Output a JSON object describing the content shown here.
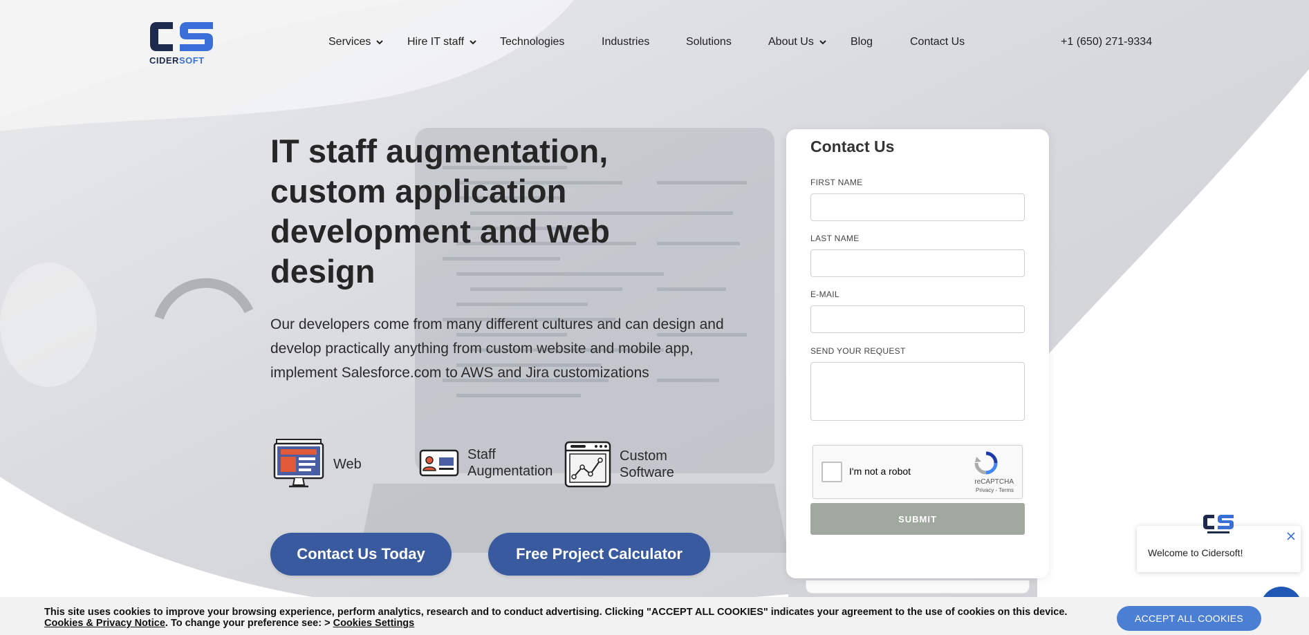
{
  "brand": {
    "logo_text_a": "CIDER",
    "logo_text_b": "SOFT",
    "color_dark": "#1d2a4d",
    "color_accent": "#3a6fd8"
  },
  "nav": {
    "items": [
      {
        "label": "Services",
        "dropdown": true
      },
      {
        "label": "Hire IT staff",
        "dropdown": true
      },
      {
        "label": "Technologies",
        "dropdown": false
      },
      {
        "label": "Industries",
        "dropdown": false
      },
      {
        "label": "Solutions",
        "dropdown": false
      },
      {
        "label": "About Us",
        "dropdown": true
      },
      {
        "label": "Blog",
        "dropdown": false
      },
      {
        "label": "Contact Us",
        "dropdown": false
      }
    ],
    "phone": "+1 (650) 271-9334"
  },
  "hero": {
    "title": "IT staff augmentation, custom application development and web design",
    "description": "Our developers come from many different cultures and can design and develop practically anything from custom website and mobile app, implement Salesforce.com to AWS and Jira customizations",
    "services": [
      {
        "label": "Web",
        "icon": "web-monitor-icon"
      },
      {
        "label": "Staff Augmentation",
        "icon": "id-card-icon"
      },
      {
        "label": "Custom Software",
        "icon": "software-chart-icon"
      }
    ],
    "cta_primary": "Contact Us Today",
    "cta_secondary": "Free Project Calculator",
    "cta_color": "#3a5aa0"
  },
  "contact_form": {
    "title": "Contact Us",
    "first_name_label": "FIRST NAME",
    "last_name_label": "LAST NAME",
    "email_label": "E-MAIL",
    "request_label": "SEND YOUR REQUEST",
    "recaptcha_label": "I'm not a robot",
    "recaptcha_brand": "reCAPTCHA",
    "recaptcha_terms": "Privacy - Terms",
    "submit_label": "SUBMIT",
    "submit_color": "#a0a89f"
  },
  "chat": {
    "message": "Welcome to Cidersoft!",
    "bubble_color": "#1e57b4"
  },
  "cookie": {
    "text": "This site uses cookies to improve your browsing experience, perform analytics, research and to conduct advertising. Clicking \"ACCEPT ALL COOKIES\" indicates your agreement to the use of cookies on this device.",
    "privacy_link": "Cookies & Privacy Notice",
    "middle_text": ". To change your preference see: > ",
    "settings_link": "Cookies Settings",
    "accept_label": "ACCEPT ALL COOKIES",
    "accept_color": "#4a7fd4"
  }
}
